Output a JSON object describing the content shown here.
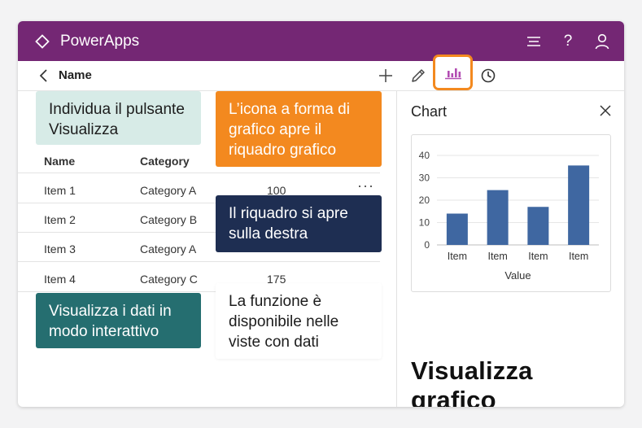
{
  "app": {
    "title": "PowerApps"
  },
  "titlebar_icons": [
    "settings-menu-icon",
    "help-icon",
    "user-icon"
  ],
  "titlebar_help_glyph": "?",
  "command_bar": {
    "field_label": "Name",
    "icons": [
      "back-icon",
      "add-icon",
      "edit-icon",
      "chart-icon",
      "history-icon"
    ],
    "highlight_color": "#f3891f"
  },
  "table": {
    "columns": [
      "Name",
      "Category"
    ],
    "rows": [
      {
        "name": "Item 1",
        "category": "Category A",
        "value": "100"
      },
      {
        "name": "Item 2",
        "category": "Category B",
        "value": ""
      },
      {
        "name": "Item 3",
        "category": "Category A",
        "value": ""
      },
      {
        "name": "Item 4",
        "category": "Category C",
        "value": "175"
      }
    ],
    "more_glyph": "···"
  },
  "callouts": {
    "find_button": "Individua il pulsante Visualizza",
    "chart_icon": "L’icona a forma di grafico apre il riquadro grafico",
    "pane_opens": "Il riquadro si apre sulla destra",
    "view_data": "Visualizza i dati in modo interattivo",
    "availability": "La funzione è disponibile nelle viste con dati"
  },
  "pane": {
    "title": "Chart",
    "caption": "Visualizza grafico"
  },
  "chart_data": {
    "type": "bar",
    "categories": [
      "Item",
      "Item",
      "Item",
      "Item"
    ],
    "values": [
      14,
      24.5,
      17,
      35.5
    ],
    "xlabel": "Value",
    "ylabel": "",
    "ylim": [
      0,
      40
    ],
    "yticks": [
      0,
      10,
      20,
      30,
      40
    ],
    "bar_color": "#3f67a1",
    "grid": true
  },
  "colors": {
    "titlebar": "#742774",
    "accent_orange": "#f3891f",
    "navy": "#1e2e52",
    "teal": "#256e70",
    "mint": "#d7ebe7"
  }
}
